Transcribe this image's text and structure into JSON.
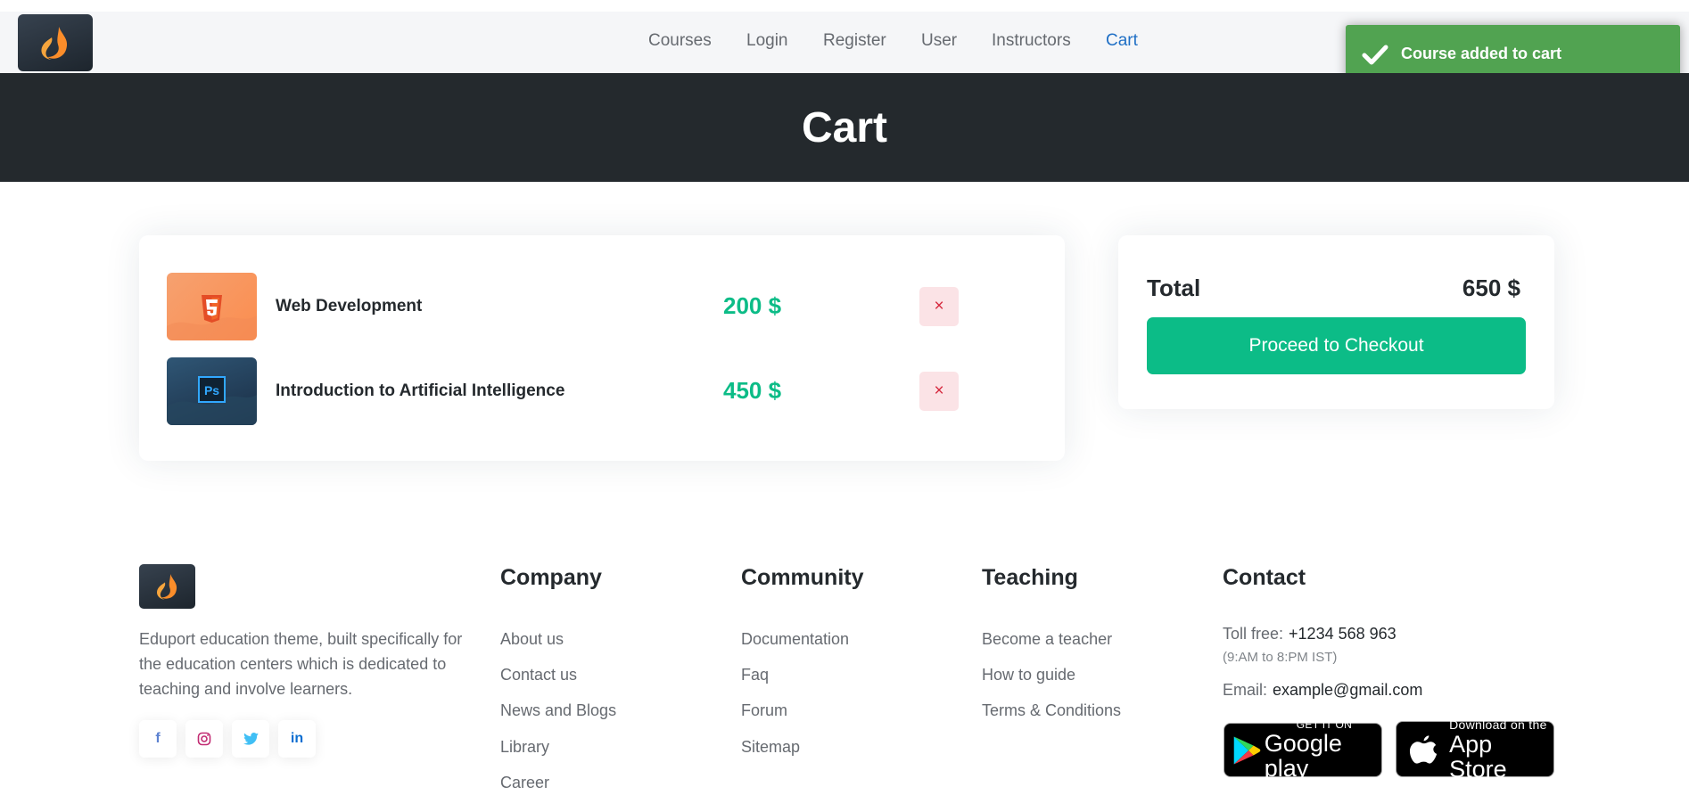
{
  "nav": {
    "links": [
      "Courses",
      "Login",
      "Register",
      "User",
      "Instructors",
      "Cart"
    ],
    "active": "Cart"
  },
  "toast": {
    "message": "Course added to cart",
    "color": "#51a351"
  },
  "page": {
    "title": "Cart"
  },
  "cart": {
    "items": [
      {
        "title": "Web Development",
        "price": "200 $",
        "icon": "html5-icon"
      },
      {
        "title": "Introduction to Artificial Intelligence",
        "price": "450 $",
        "icon": "photoshop-icon"
      }
    ],
    "remove_label": "×"
  },
  "summary": {
    "total_label": "Total",
    "total_value": "650 $",
    "checkout_label": "Proceed to Checkout"
  },
  "footer": {
    "description": "Eduport education theme, built specifically for the education centers which is dedicated to teaching and involve learners.",
    "social": [
      {
        "icon": "facebook-icon",
        "glyph": "f"
      },
      {
        "icon": "instagram-icon",
        "glyph": "◎"
      },
      {
        "icon": "twitter-icon",
        "glyph": "🐦"
      },
      {
        "icon": "linkedin-icon",
        "glyph": "in"
      }
    ],
    "columns": [
      {
        "heading": "Company",
        "links": [
          "About us",
          "Contact us",
          "News and Blogs",
          "Library",
          "Career"
        ]
      },
      {
        "heading": "Community",
        "links": [
          "Documentation",
          "Faq",
          "Forum",
          "Sitemap"
        ]
      },
      {
        "heading": "Teaching",
        "links": [
          "Become a teacher",
          "How to guide",
          "Terms & Conditions"
        ]
      }
    ],
    "contact": {
      "heading": "Contact",
      "toll_free_label": "Toll free:",
      "toll_free_value": "+1234 568 963",
      "hours": "(9:AM to 8:PM IST)",
      "email_label": "Email:",
      "email_value": "example@gmail.com"
    },
    "badges": {
      "google_small": "GET IT ON",
      "google_big": "Google play",
      "apple_small": "Download on the",
      "apple_big": "App Store"
    }
  },
  "colors": {
    "accent": "#0cbc87",
    "dark": "#24292d",
    "link_active": "#1f6fc5",
    "danger": "#d6293e"
  }
}
